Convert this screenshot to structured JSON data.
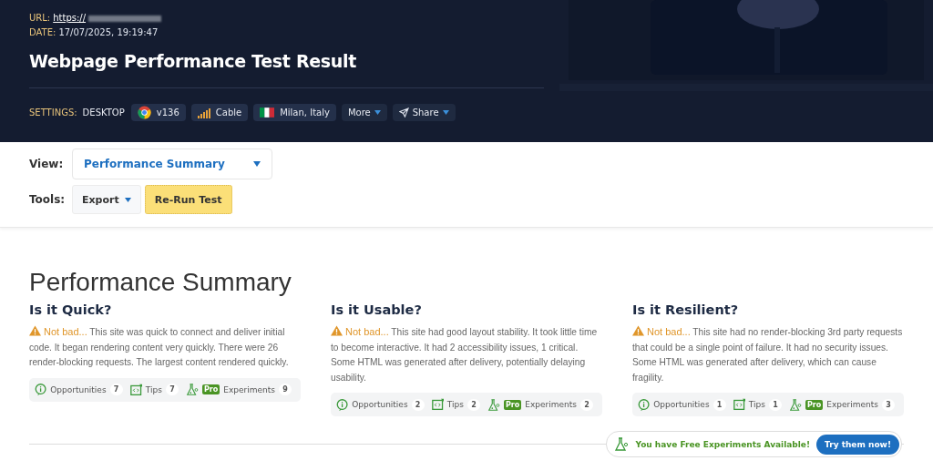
{
  "header": {
    "url_label": "URL:",
    "url": "https://",
    "date_label": "DATE:",
    "date": "17/07/2025, 19:19:47",
    "title": "Webpage Performance Test Result",
    "settings_label": "SETTINGS:",
    "device": "DESKTOP",
    "chips": [
      {
        "kind": "browser",
        "label": "v136"
      },
      {
        "kind": "connection",
        "label": "Cable"
      },
      {
        "kind": "location",
        "label": "Milan, Italy"
      },
      {
        "kind": "more",
        "label": "More"
      },
      {
        "kind": "share",
        "label": "Share"
      }
    ]
  },
  "view": {
    "label": "View:",
    "value": "Performance Summary"
  },
  "tools": {
    "label": "Tools:",
    "export": "Export",
    "rerun": "Re-Run Test"
  },
  "summary": {
    "title": "Performance Summary",
    "sections": [
      {
        "title": "Is it Quick?",
        "kind": "warning",
        "verdict": "Not bad...",
        "text": "This site was quick to connect and deliver initial code. It began rendering content very quickly. There were 26 render-blocking requests. The largest content rendered quickly.",
        "stats": [
          {
            "kind": "opportunities",
            "label": "Opportunities",
            "count": "7"
          },
          {
            "kind": "tips",
            "label": "Tips",
            "count": "7"
          },
          {
            "kind": "experiments",
            "badge": "Pro",
            "label": "Experiments",
            "count": "9"
          }
        ]
      },
      {
        "title": "Is it Usable?",
        "kind": "warning",
        "verdict": "Not bad...",
        "text": "This site had good layout stability. It took little time to become interactive. It had 2 accessibility issues, 1 critical. Some HTML was generated after delivery, potentially delaying usability.",
        "stats": [
          {
            "kind": "opportunities",
            "label": "Opportunities",
            "count": "2"
          },
          {
            "kind": "tips",
            "label": "Tips",
            "count": "2"
          },
          {
            "kind": "experiments",
            "badge": "Pro",
            "label": "Experiments",
            "count": "2"
          }
        ]
      },
      {
        "title": "Is it Resilient?",
        "kind": "warning",
        "verdict": "Not bad...",
        "text": "This site had no render-blocking 3rd party requests that could be a single point of failure. It had no security issues. Some HTML was generated after delivery, which can cause fragility.",
        "stats": [
          {
            "kind": "opportunities",
            "label": "Opportunities",
            "count": "1"
          },
          {
            "kind": "tips",
            "label": "Tips",
            "count": "1"
          },
          {
            "kind": "experiments",
            "badge": "Pro",
            "label": "Experiments",
            "count": "3"
          }
        ]
      }
    ],
    "promo": {
      "text": "You have Free Experiments Available!",
      "button": "Try them now!"
    }
  }
}
